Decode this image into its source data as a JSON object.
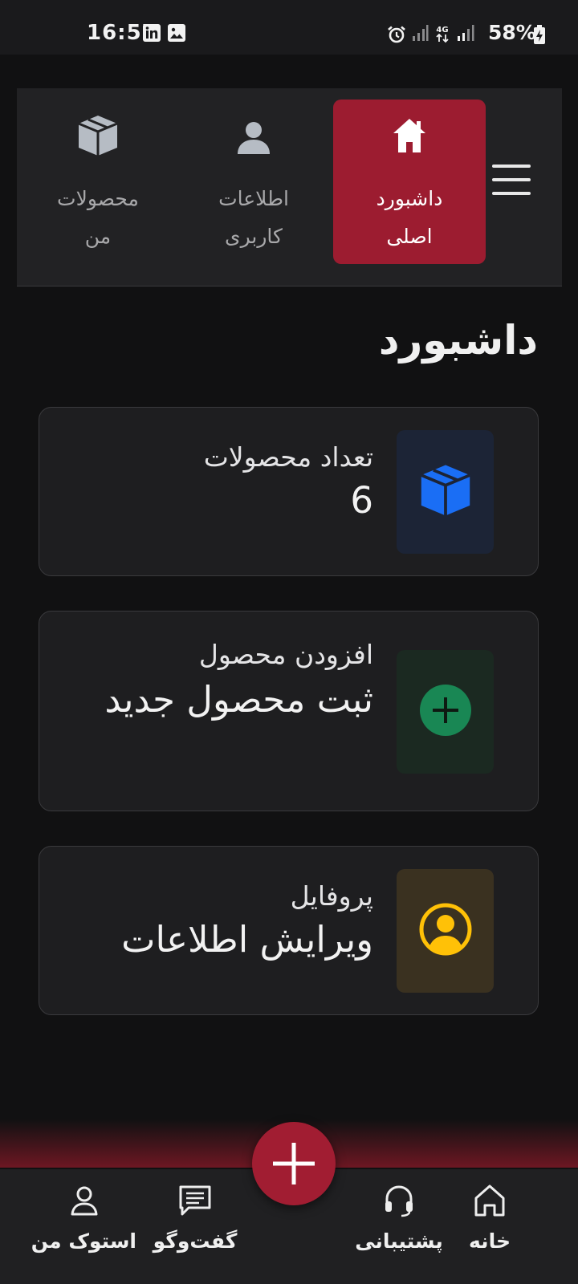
{
  "status_bar": {
    "time": "16:57",
    "battery": "58%",
    "network": "4G"
  },
  "top_nav": {
    "items": [
      {
        "label": "داشبورد\nاصلی",
        "icon": "home-icon",
        "active": true
      },
      {
        "label": "اطلاعات\nکاربری",
        "icon": "user-icon",
        "active": false
      },
      {
        "label": "محصولات\nمن",
        "icon": "box-icon",
        "active": false
      }
    ]
  },
  "page_title": "داشبورد",
  "cards": [
    {
      "label": "تعداد محصولات",
      "value": "6",
      "icon": "box-icon",
      "color": "#1a6ef5"
    },
    {
      "label": "افزودن محصول",
      "value": "ثبت محصول جدید",
      "icon": "plus-circle-icon",
      "color": "#198754"
    },
    {
      "label": "پروفایل",
      "value": "ویرایش اطلاعات",
      "icon": "user-circle-icon",
      "color": "#ffc107"
    }
  ],
  "bottom_nav": {
    "items": [
      {
        "label": "خانه",
        "icon": "home-outline-icon"
      },
      {
        "label": "پشتیبانی",
        "icon": "headset-icon"
      },
      {
        "label": "گفت‌وگو",
        "icon": "chat-icon"
      },
      {
        "label": "استوک من",
        "icon": "user-outline-icon"
      }
    ],
    "fab_icon": "plus-icon"
  },
  "colors": {
    "accent": "#9c1c30",
    "background": "#111112",
    "card": "#1e1e20"
  }
}
